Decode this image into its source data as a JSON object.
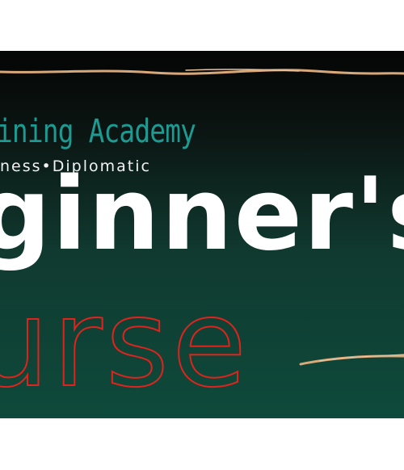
{
  "banner": {
    "academy_text": "ining Academy",
    "tagline": "ness•Diplomatic",
    "headline_line1": "ginner's",
    "headline_line2": "urse"
  },
  "colors": {
    "background_top": "#050505",
    "background_bottom": "#0e4a3b",
    "academy_teal": "#1d9a91",
    "outline_red": "#e0231c",
    "brush_gold": "#d9a878"
  }
}
